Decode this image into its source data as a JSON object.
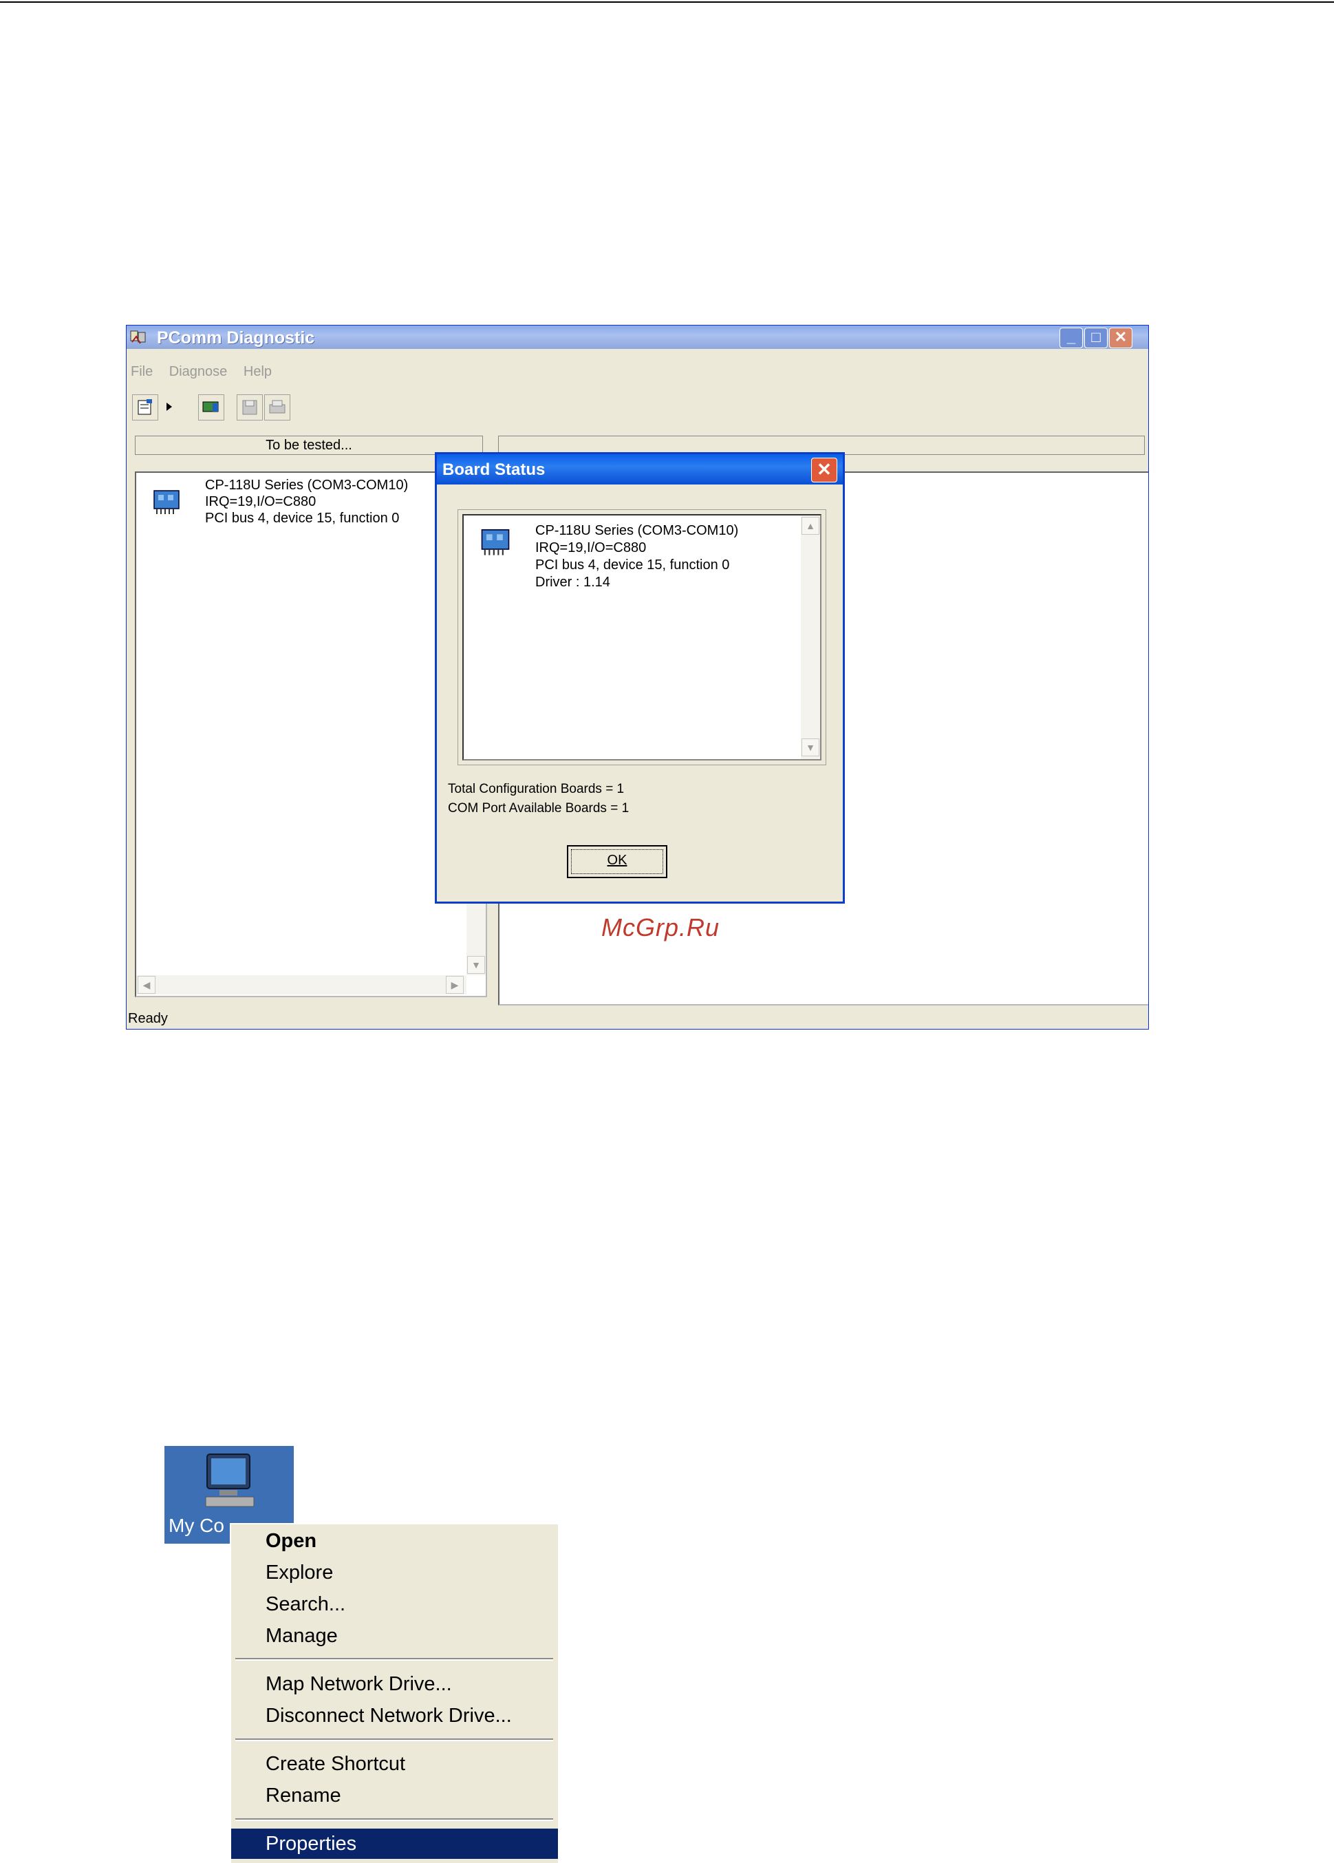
{
  "pcomm": {
    "title": "PComm Diagnostic",
    "menu": [
      "File",
      "Diagnose",
      "Help"
    ],
    "left_column_header": "To be tested...",
    "tree_lines": [
      "CP-118U Series  (COM3-COM10)",
      "IRQ=19,I/O=C880",
      "PCI bus 4, device 15, function 0"
    ],
    "status": "Ready"
  },
  "dialog": {
    "title": "Board Status",
    "close_glyph": "✕",
    "list_lines": [
      "CP-118U Series  (COM3-COM10)",
      "IRQ=19,I/O=C880",
      "PCI bus 4, device 15, function 0",
      "Driver : 1.14"
    ],
    "total_config": "Total Configuration Boards = 1",
    "com_available": "COM Port Available Boards = 1",
    "ok_label": "OK"
  },
  "watermark": "McGrp.Ru",
  "desktop": {
    "icon_label": "My Co"
  },
  "context_menu": {
    "items": [
      "Open",
      "Explore",
      "Search...",
      "Manage",
      "Map Network Drive...",
      "Disconnect Network Drive...",
      "Create Shortcut",
      "Rename",
      "Properties"
    ]
  },
  "colors": {
    "xp_title_blue": "#0a5fe8",
    "inactive_title": "#8aa9e6",
    "menu_highlight": "#0a246a",
    "watermark_red": "#c0392b"
  }
}
